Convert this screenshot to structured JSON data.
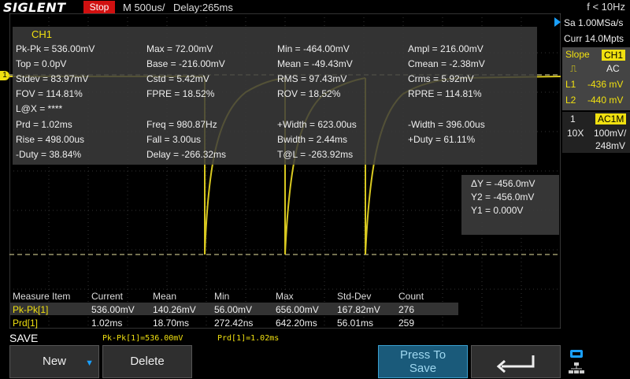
{
  "header": {
    "logo": "SIGLENT",
    "run_state": "Stop",
    "timebase": "M 500us/",
    "delay": "Delay:265ms",
    "trigger_freq": "f < 10Hz"
  },
  "acquisition": {
    "sample_rate": "Sa 1.00MSa/s",
    "memory": "Curr 14.0Mpts"
  },
  "trigger": {
    "slope_label": "Slope",
    "source": "CH1",
    "coupling": "AC",
    "l1": "L1",
    "l1_value": "-436 mV",
    "l2": "L2",
    "l2_value": "-440 mV"
  },
  "channel": {
    "number": "1",
    "coupling": "AC1M",
    "probe": "10X",
    "scale": "100mV/",
    "offset": "248mV"
  },
  "measure_panel": {
    "title": "CH1",
    "items": [
      "Pk-Pk = 536.00mV",
      "Max = 72.00mV",
      "Min = -464.00mV",
      "Ampl = 216.00mV",
      "Top = 0.0pV",
      "Base = -216.00mV",
      "Mean = -49.43mV",
      "Cmean = -2.38mV",
      "Stdev = 83.97mV",
      "Cstd = 5.42mV",
      "RMS = 97.43mV",
      "Crms = 5.92mV",
      "FOV = 114.81%",
      "FPRE = 18.52%",
      "ROV = 18.52%",
      "RPRE = 114.81%",
      "L@X = ****",
      "Prd = 1.02ms",
      "Freq = 980.87Hz",
      "+Width = 623.00us",
      "-Width = 396.00us",
      "Rise = 498.00us",
      "Fall = 3.00us",
      "Bwidth = 2.44ms",
      "+Duty = 61.11%",
      "-Duty = 38.84%",
      "Delay = -266.32ms",
      "T@L = -263.92ms"
    ]
  },
  "cursors": {
    "dy": "ΔY = -456.0mV",
    "y2": "Y2 = -456.0mV",
    "y1": "Y1 = 0.000V"
  },
  "stats": {
    "headers": [
      "Measure Item",
      "Current",
      "Mean",
      "Min",
      "Max",
      "Std-Dev",
      "Count"
    ],
    "rows": [
      [
        "Pk-Pk[1]",
        "536.00mV",
        "140.26mV",
        "56.00mV",
        "656.00mV",
        "167.82mV",
        "276"
      ],
      [
        "Prd[1]",
        "1.02ms",
        "18.70ms",
        "272.42ns",
        "642.20ms",
        "56.01ms",
        "259"
      ]
    ]
  },
  "footer": {
    "menu_title": "SAVE",
    "readout_1": "Pk-Pk[1]=536.00mV",
    "readout_2": "Prd[1]=1.02ms",
    "new_label": "New",
    "delete_label": "Delete",
    "press_to": "Press To",
    "save": "Save"
  },
  "colors": {
    "channel1": "#f0e010",
    "stop": "#d01010",
    "highlight_button": "#1a5a7a"
  }
}
